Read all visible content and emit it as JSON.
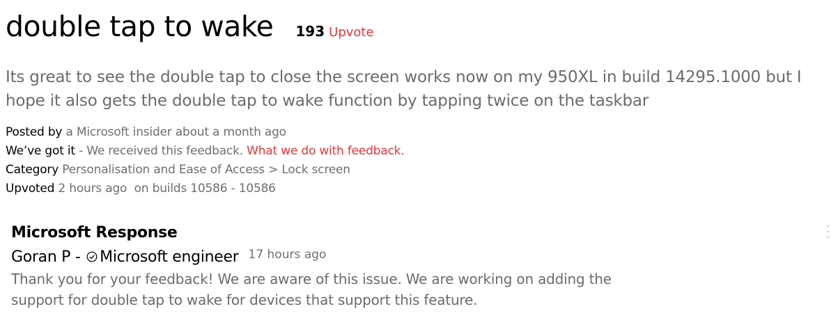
{
  "post": {
    "title": "double tap to wake",
    "vote_count": "193",
    "upvote_label": "Upvote",
    "description": "Its great to see the double tap to close the screen works now on my 950XL in build 14295.1000 but I hope it also gets the double tap to wake function by tapping twice on the taskbar"
  },
  "meta": {
    "posted_label": "Posted by",
    "posted_value": " a Microsoft insider about a month ago",
    "status_label": "We’ve got it",
    "status_value": " - We received this feedback. ",
    "status_link": "What we do with feedback.",
    "category_label": "Category",
    "category_value": " Personalisation and Ease of Access > Lock screen",
    "upvoted_label": "Upvoted",
    "upvoted_value": " 2 hours ago  on builds 10586 - 10586"
  },
  "response": {
    "heading": "Microsoft Response",
    "author_name": "Goran P - ",
    "author_role": "Microsoft engineer",
    "author_icon": "verified-check-icon",
    "time": "17 hours ago",
    "body": "Thank you for your feedback! We are aware of this issue. We are working on adding the support for double tap to wake for devices that support this feature."
  },
  "colors": {
    "accent_red": "#e2363a",
    "secondary_text": "#6b6b6b"
  }
}
